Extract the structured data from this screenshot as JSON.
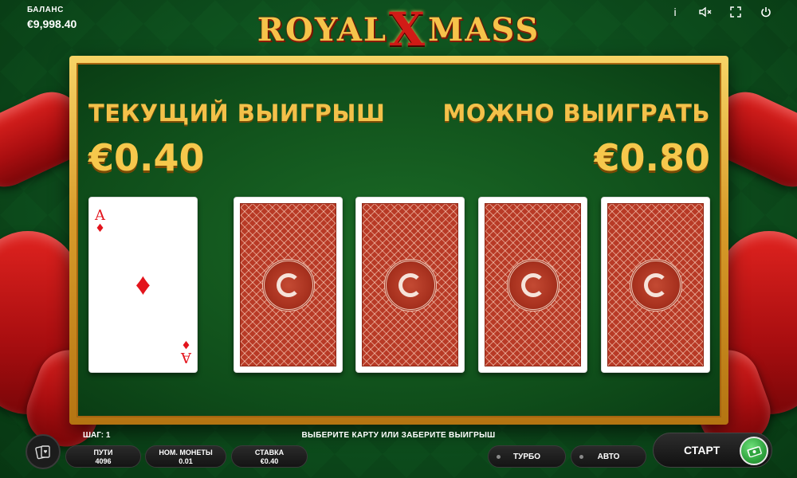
{
  "balance": {
    "label": "БАЛАНС",
    "value": "€9,998.40"
  },
  "logo": {
    "part1": "ROYAL",
    "x": "X",
    "part2": "MASS"
  },
  "top_icons": [
    "info-icon",
    "mute-icon",
    "fullscreen-icon",
    "power-icon"
  ],
  "top_icon_glyphs": {
    "info": "i",
    "mute": "🔇",
    "fullscreen": "⛶",
    "power": "⏻"
  },
  "gamble": {
    "current_win_label": "ТЕКУЩИЙ ВЫИГРЫШ",
    "current_win_value": "€0.40",
    "possible_win_label": "МОЖНО ВЫИГРАТЬ",
    "possible_win_value": "€0.80",
    "dealer_card": {
      "rank": "A",
      "suit": "♦"
    },
    "hidden_cards_count": 4
  },
  "bottom": {
    "step": "ШАГ: 1",
    "hint": "ВЫБЕРИТЕ КАРТУ ИЛИ ЗАБЕРИТЕ ВЫИГРЫШ",
    "lines": {
      "label": "ПУТИ",
      "value": "4096"
    },
    "coin": {
      "label": "НОМ. МОНЕТЫ",
      "value": "0.01"
    },
    "bet": {
      "label": "СТАВКА",
      "value": "€0.40"
    },
    "turbo": "ТУРБО",
    "auto": "АВТО",
    "start": "СТАРТ"
  },
  "colors": {
    "gold": "#f3c14a",
    "felt": "#0f4d1a",
    "ribbon": "#c8161a",
    "card_back": "#b83a26",
    "start_icon": "#2fa43e"
  }
}
